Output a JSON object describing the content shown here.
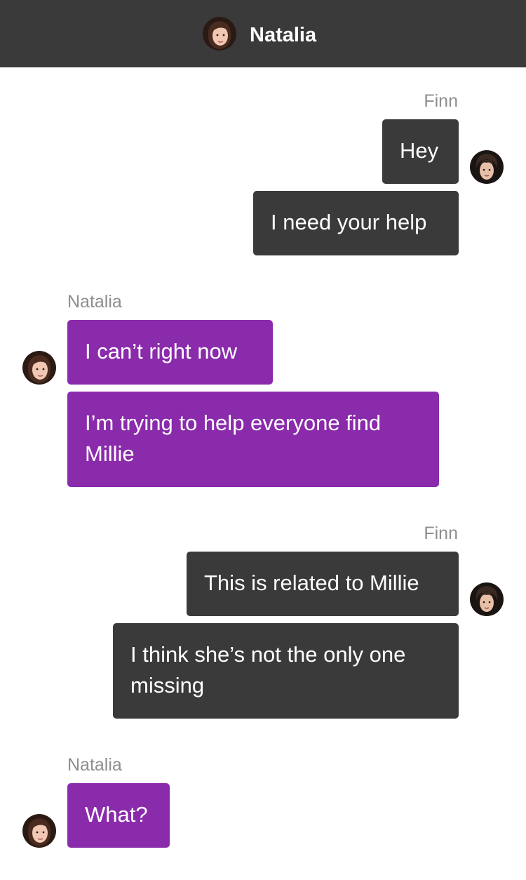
{
  "header": {
    "title": "Natalia",
    "avatar_icon": "natalia-avatar-icon"
  },
  "colors": {
    "header_bg": "#3a3a3a",
    "outgoing_bubble": "#3a3a3a",
    "incoming_bubble": "#8a2bab",
    "sender_label": "#8e8e8e"
  },
  "messages": [
    {
      "sender": "Finn",
      "direction": "outgoing",
      "texts": [
        "Hey",
        "I need your help"
      ]
    },
    {
      "sender": "Natalia",
      "direction": "incoming",
      "texts": [
        "I can’t right now",
        "I’m trying to help everyone find Millie"
      ]
    },
    {
      "sender": "Finn",
      "direction": "outgoing",
      "texts": [
        "This is related to Millie",
        "I think she’s not the only one missing"
      ]
    },
    {
      "sender": "Natalia",
      "direction": "incoming",
      "texts": [
        "What?"
      ]
    }
  ]
}
